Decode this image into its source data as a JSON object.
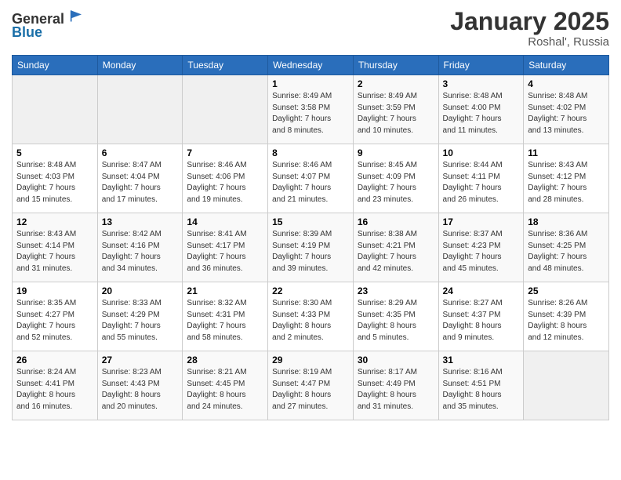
{
  "header": {
    "logo_line1": "General",
    "logo_line2": "Blue",
    "month": "January 2025",
    "location": "Roshal', Russia"
  },
  "weekdays": [
    "Sunday",
    "Monday",
    "Tuesday",
    "Wednesday",
    "Thursday",
    "Friday",
    "Saturday"
  ],
  "weeks": [
    [
      {
        "day": "",
        "info": ""
      },
      {
        "day": "",
        "info": ""
      },
      {
        "day": "",
        "info": ""
      },
      {
        "day": "1",
        "info": "Sunrise: 8:49 AM\nSunset: 3:58 PM\nDaylight: 7 hours\nand 8 minutes."
      },
      {
        "day": "2",
        "info": "Sunrise: 8:49 AM\nSunset: 3:59 PM\nDaylight: 7 hours\nand 10 minutes."
      },
      {
        "day": "3",
        "info": "Sunrise: 8:48 AM\nSunset: 4:00 PM\nDaylight: 7 hours\nand 11 minutes."
      },
      {
        "day": "4",
        "info": "Sunrise: 8:48 AM\nSunset: 4:02 PM\nDaylight: 7 hours\nand 13 minutes."
      }
    ],
    [
      {
        "day": "5",
        "info": "Sunrise: 8:48 AM\nSunset: 4:03 PM\nDaylight: 7 hours\nand 15 minutes."
      },
      {
        "day": "6",
        "info": "Sunrise: 8:47 AM\nSunset: 4:04 PM\nDaylight: 7 hours\nand 17 minutes."
      },
      {
        "day": "7",
        "info": "Sunrise: 8:46 AM\nSunset: 4:06 PM\nDaylight: 7 hours\nand 19 minutes."
      },
      {
        "day": "8",
        "info": "Sunrise: 8:46 AM\nSunset: 4:07 PM\nDaylight: 7 hours\nand 21 minutes."
      },
      {
        "day": "9",
        "info": "Sunrise: 8:45 AM\nSunset: 4:09 PM\nDaylight: 7 hours\nand 23 minutes."
      },
      {
        "day": "10",
        "info": "Sunrise: 8:44 AM\nSunset: 4:11 PM\nDaylight: 7 hours\nand 26 minutes."
      },
      {
        "day": "11",
        "info": "Sunrise: 8:43 AM\nSunset: 4:12 PM\nDaylight: 7 hours\nand 28 minutes."
      }
    ],
    [
      {
        "day": "12",
        "info": "Sunrise: 8:43 AM\nSunset: 4:14 PM\nDaylight: 7 hours\nand 31 minutes."
      },
      {
        "day": "13",
        "info": "Sunrise: 8:42 AM\nSunset: 4:16 PM\nDaylight: 7 hours\nand 34 minutes."
      },
      {
        "day": "14",
        "info": "Sunrise: 8:41 AM\nSunset: 4:17 PM\nDaylight: 7 hours\nand 36 minutes."
      },
      {
        "day": "15",
        "info": "Sunrise: 8:39 AM\nSunset: 4:19 PM\nDaylight: 7 hours\nand 39 minutes."
      },
      {
        "day": "16",
        "info": "Sunrise: 8:38 AM\nSunset: 4:21 PM\nDaylight: 7 hours\nand 42 minutes."
      },
      {
        "day": "17",
        "info": "Sunrise: 8:37 AM\nSunset: 4:23 PM\nDaylight: 7 hours\nand 45 minutes."
      },
      {
        "day": "18",
        "info": "Sunrise: 8:36 AM\nSunset: 4:25 PM\nDaylight: 7 hours\nand 48 minutes."
      }
    ],
    [
      {
        "day": "19",
        "info": "Sunrise: 8:35 AM\nSunset: 4:27 PM\nDaylight: 7 hours\nand 52 minutes."
      },
      {
        "day": "20",
        "info": "Sunrise: 8:33 AM\nSunset: 4:29 PM\nDaylight: 7 hours\nand 55 minutes."
      },
      {
        "day": "21",
        "info": "Sunrise: 8:32 AM\nSunset: 4:31 PM\nDaylight: 7 hours\nand 58 minutes."
      },
      {
        "day": "22",
        "info": "Sunrise: 8:30 AM\nSunset: 4:33 PM\nDaylight: 8 hours\nand 2 minutes."
      },
      {
        "day": "23",
        "info": "Sunrise: 8:29 AM\nSunset: 4:35 PM\nDaylight: 8 hours\nand 5 minutes."
      },
      {
        "day": "24",
        "info": "Sunrise: 8:27 AM\nSunset: 4:37 PM\nDaylight: 8 hours\nand 9 minutes."
      },
      {
        "day": "25",
        "info": "Sunrise: 8:26 AM\nSunset: 4:39 PM\nDaylight: 8 hours\nand 12 minutes."
      }
    ],
    [
      {
        "day": "26",
        "info": "Sunrise: 8:24 AM\nSunset: 4:41 PM\nDaylight: 8 hours\nand 16 minutes."
      },
      {
        "day": "27",
        "info": "Sunrise: 8:23 AM\nSunset: 4:43 PM\nDaylight: 8 hours\nand 20 minutes."
      },
      {
        "day": "28",
        "info": "Sunrise: 8:21 AM\nSunset: 4:45 PM\nDaylight: 8 hours\nand 24 minutes."
      },
      {
        "day": "29",
        "info": "Sunrise: 8:19 AM\nSunset: 4:47 PM\nDaylight: 8 hours\nand 27 minutes."
      },
      {
        "day": "30",
        "info": "Sunrise: 8:17 AM\nSunset: 4:49 PM\nDaylight: 8 hours\nand 31 minutes."
      },
      {
        "day": "31",
        "info": "Sunrise: 8:16 AM\nSunset: 4:51 PM\nDaylight: 8 hours\nand 35 minutes."
      },
      {
        "day": "",
        "info": ""
      }
    ]
  ]
}
